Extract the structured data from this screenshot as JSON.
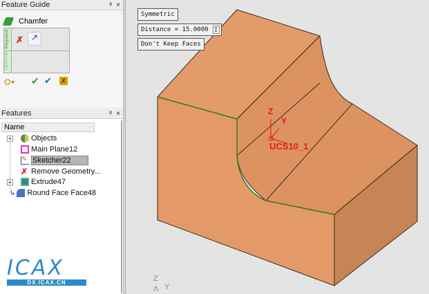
{
  "feature_guide": {
    "title": "Feature Guide",
    "pin": "ᵖ",
    "close": "×",
    "command": "Chamfer",
    "required_label": "Required",
    "optional_label": "Optional"
  },
  "features": {
    "title": "Features",
    "pin": "ᵖ",
    "close": "×",
    "column": "Name",
    "items": [
      {
        "label": "Objects",
        "expand": "+"
      },
      {
        "label": "Main Plane12"
      },
      {
        "label": "Sketcher22"
      },
      {
        "label": "Remove Geometry..."
      },
      {
        "label": "Extrude47",
        "expand": "+"
      },
      {
        "label": "Round Face Face48"
      }
    ]
  },
  "logo": {
    "text": "ICAX",
    "subtext": "DX.ICAX.CN"
  },
  "viewport": {
    "symmetric": "Symmetric",
    "distance": "Distance = 15.0000",
    "keep_faces": "Don't Keep Faces",
    "ucs_label": "UCS10_1",
    "axis_z": "Z",
    "axis_y": "Y",
    "triad_z": "Z",
    "triad_y": "Y"
  },
  "colors": {
    "face": "#e39a68",
    "side": "#c68457",
    "edge_green": "#2f7a2a",
    "ucs": "#e21b1b"
  }
}
